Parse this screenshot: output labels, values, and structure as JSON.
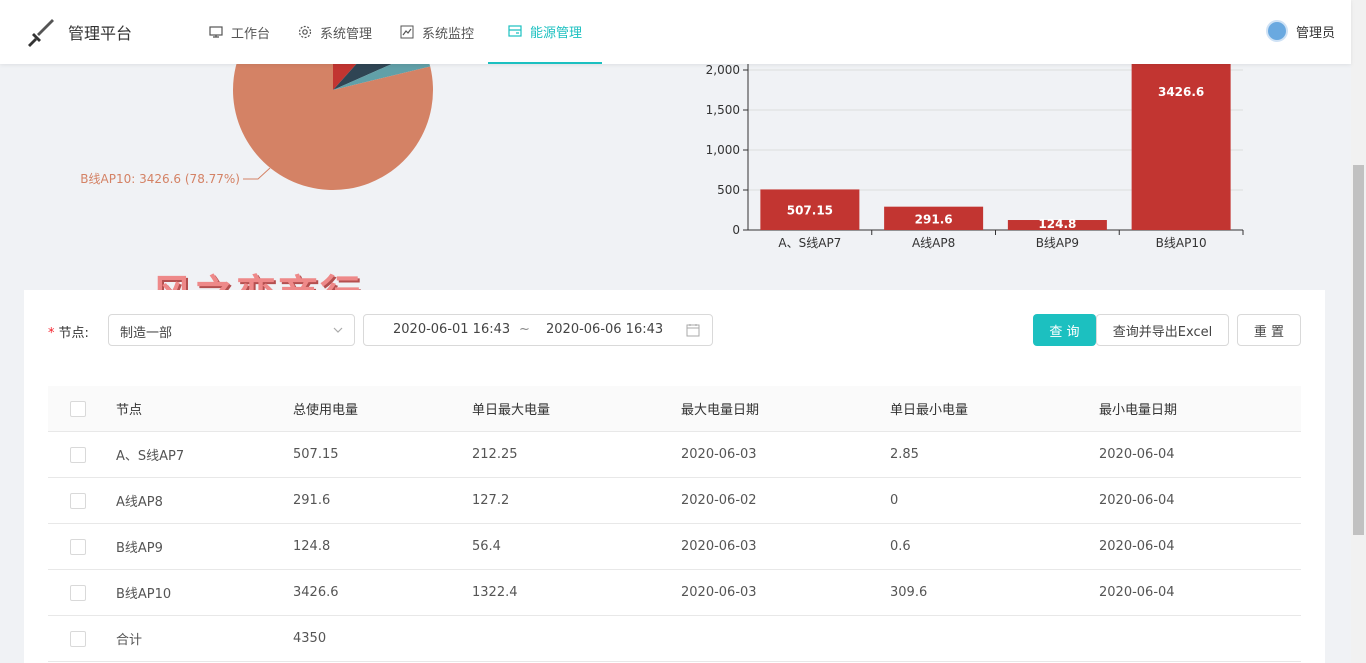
{
  "app": {
    "title": "管理平台",
    "user": "管理员"
  },
  "nav": {
    "items": [
      {
        "label": "工作台",
        "icon": "monitor-icon"
      },
      {
        "label": "系统管理",
        "icon": "gear-icon"
      },
      {
        "label": "系统监控",
        "icon": "line-chart-icon"
      },
      {
        "label": "能源管理",
        "icon": "card-icon",
        "active": true
      }
    ]
  },
  "watermark": "风之恋商行",
  "chart_data": [
    {
      "type": "pie",
      "slices": [
        {
          "label": "A、S线AP7",
          "value": 507.15
        },
        {
          "label": "A线AP8",
          "value": 291.6
        },
        {
          "label": "B线AP9",
          "value": 124.8
        },
        {
          "label": "B线AP10",
          "value": 3426.6,
          "percent": 78.77
        }
      ],
      "visible_label": "B线AP10: 3426.6 (78.77%)",
      "colors": [
        "#c23531",
        "#2f4554",
        "#61a0a8",
        "#d48265"
      ]
    },
    {
      "type": "bar",
      "categories": [
        "A、S线AP7",
        "A线AP8",
        "B线AP9",
        "B线AP10"
      ],
      "values": [
        507.15,
        291.6,
        124.8,
        3426.6
      ],
      "value_labels": [
        "507.15",
        "291.6",
        "124.8",
        "3426.6"
      ],
      "yticks": [
        "0",
        "500",
        "1,000",
        "1,500",
        "2,000"
      ],
      "ylim": [
        0,
        2000
      ],
      "color": "#c23531"
    }
  ],
  "filter": {
    "node_label": "节点:",
    "node_value": "制造一部",
    "date_start": "2020-06-01 16:43",
    "date_sep": "~",
    "date_end": "2020-06-06 16:43",
    "query_label": "查 询",
    "export_label": "查询并导出Excel",
    "reset_label": "重 置"
  },
  "table": {
    "headers": [
      "节点",
      "总使用电量",
      "单日最大电量",
      "最大电量日期",
      "单日最小电量",
      "最小电量日期"
    ],
    "rows": [
      [
        "A、S线AP7",
        "507.15",
        "212.25",
        "2020-06-03",
        "2.85",
        "2020-06-04"
      ],
      [
        "A线AP8",
        "291.6",
        "127.2",
        "2020-06-02",
        "0",
        "2020-06-04"
      ],
      [
        "B线AP9",
        "124.8",
        "56.4",
        "2020-06-03",
        "0.6",
        "2020-06-04"
      ],
      [
        "B线AP10",
        "3426.6",
        "1322.4",
        "2020-06-03",
        "309.6",
        "2020-06-04"
      ],
      [
        "合计",
        "4350",
        "",
        "",
        "",
        ""
      ]
    ]
  }
}
